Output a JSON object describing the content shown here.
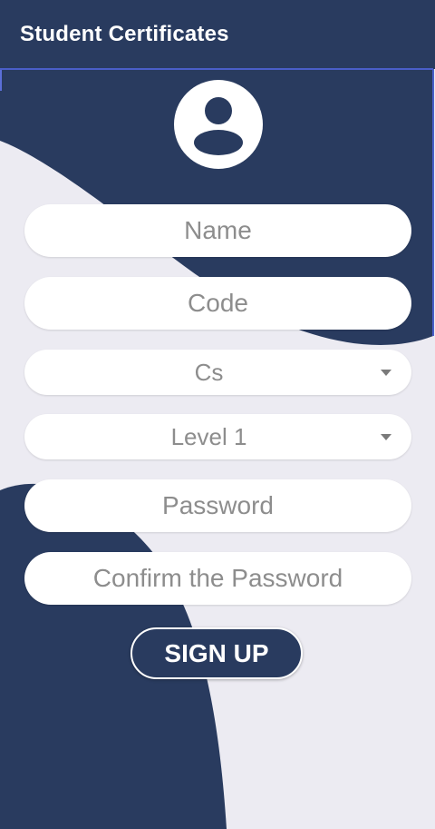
{
  "app": {
    "title": "Student Certificates"
  },
  "form": {
    "name_placeholder": "Name",
    "code_placeholder": "Code",
    "department_value": "Cs",
    "level_value": "Level 1",
    "password_placeholder": "Password",
    "confirm_password_placeholder": "Confirm the Password",
    "signup_label": "SIGN UP"
  },
  "icons": {
    "avatar": "account-circle-icon",
    "dropdown": "caret-down-icon"
  },
  "colors": {
    "primary": "#293b5f",
    "background": "#ecebf2",
    "field": "#ffffff",
    "placeholder": "#8d8d8d"
  }
}
